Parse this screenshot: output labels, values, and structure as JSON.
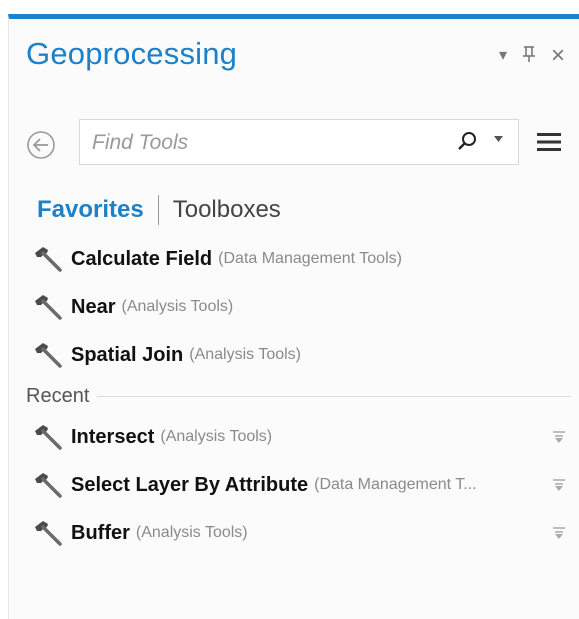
{
  "pane": {
    "title": "Geoprocessing",
    "controls": {
      "dropdown": "▾",
      "pin": "⊥",
      "close": "×"
    }
  },
  "search": {
    "placeholder": "Find Tools"
  },
  "tabs": {
    "favorites": "Favorites",
    "toolboxes": "Toolboxes"
  },
  "favorites": [
    {
      "name": "Calculate Field",
      "toolbox": "(Data Management Tools)"
    },
    {
      "name": "Near",
      "toolbox": "(Analysis Tools)"
    },
    {
      "name": "Spatial Join",
      "toolbox": "(Analysis Tools)"
    }
  ],
  "recent": {
    "label": "Recent",
    "items": [
      {
        "name": "Intersect",
        "toolbox": "(Analysis Tools)"
      },
      {
        "name": "Select Layer By Attribute",
        "toolbox": "(Data Management T..."
      },
      {
        "name": "Buffer",
        "toolbox": "(Analysis Tools)"
      }
    ]
  },
  "colors": {
    "accent": "#1a82d3",
    "title": "#1e80c8",
    "muted": "#8a8a8a"
  },
  "icons": [
    "back-arrow-icon",
    "search-icon",
    "chevron-down-icon",
    "hamburger-menu-icon",
    "hammer-icon",
    "pin-toggle-icon"
  ]
}
